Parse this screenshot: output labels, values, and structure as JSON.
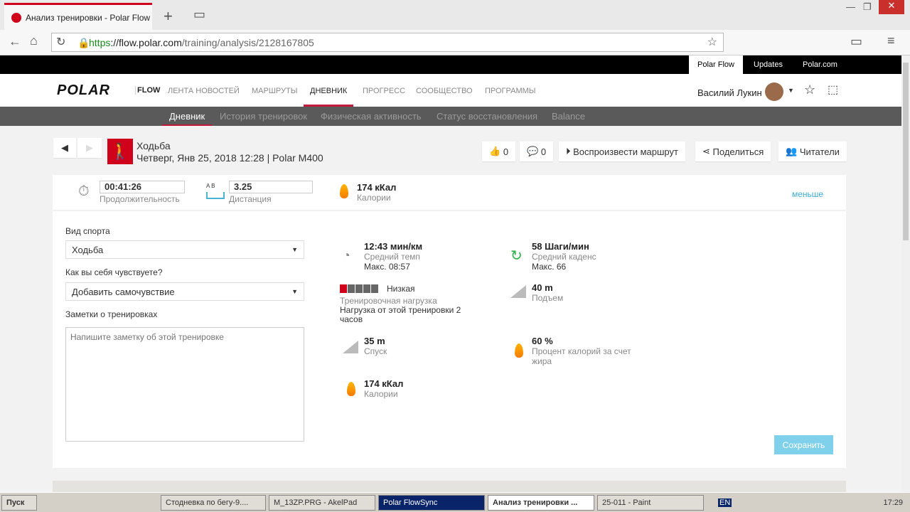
{
  "browser": {
    "tab_title": "Анализ тренировки - Polar Flow",
    "url_scheme": "https",
    "url_host": "://flow.polar.com",
    "url_path": "/training/analysis/2128167805"
  },
  "topbar": {
    "links": [
      "Polar Flow",
      "Updates",
      "Polar.com"
    ]
  },
  "nav": {
    "logo": "POLAR",
    "flow": "FLOW",
    "items": [
      "ЛЕНТА НОВОСТЕЙ",
      "МАРШРУТЫ",
      "ДНЕВНИК",
      "ПРОГРЕСС",
      "СООБЩЕСТВО",
      "ПРОГРАММЫ"
    ],
    "user": "Василий Лукин"
  },
  "subnav": [
    "Дневник",
    "История тренировок",
    "Физическая активность",
    "Статус восстановления",
    "Balance"
  ],
  "session": {
    "sport": "Ходьба",
    "date": "Четверг, Янв 25, 2018 12:28 | Polar M400",
    "likes": "0",
    "comments": "0",
    "replay": "Воспроизвести маршрут",
    "share": "Поделиться",
    "readers": "Читатели"
  },
  "summary": {
    "duration": "00:41:26",
    "duration_label": "Продолжительность",
    "ab": "A  B",
    "distance": "3.25",
    "distance_label": "Дистанция",
    "calories": "174 кКал",
    "calories_label": "Калории",
    "less": "меньше"
  },
  "form": {
    "sport_label": "Вид спорта",
    "sport_value": "Ходьба",
    "feel_label": "Как вы себя чувствуете?",
    "feel_value": "Добавить самочувствие",
    "notes_label": "Заметки о тренировках",
    "notes_placeholder": "Напишите заметку об этой тренировке",
    "save": "Сохранить"
  },
  "stats": {
    "pace": {
      "value": "12:43 мин/км",
      "label": "Средний темп",
      "sub": "Макс. 08:57"
    },
    "cadence": {
      "value": "58 Шаги/мин",
      "label": "Средний каденс",
      "sub": "Макс. 66"
    },
    "load": {
      "value": "Низкая",
      "label": "Тренировочная нагрузка",
      "sub": "Нагрузка от этой тренировки 2 часов"
    },
    "ascent": {
      "value": "40 m",
      "label": "Подъем"
    },
    "descent": {
      "value": "35 m",
      "label": "Спуск"
    },
    "fat": {
      "value": "60 %",
      "label": "Процент калорий за счет жира"
    },
    "cal": {
      "value": "174 кКал",
      "label": "Калории"
    }
  },
  "taskbar": {
    "start": "Пуск",
    "tasks": [
      "Стодневка по бегу-9....",
      "M_13ZP.PRG - AkelPad",
      "Polar FlowSync",
      "Анализ тренировки ...",
      "25-011 - Paint"
    ],
    "lang": "EN",
    "time": "17:29"
  }
}
